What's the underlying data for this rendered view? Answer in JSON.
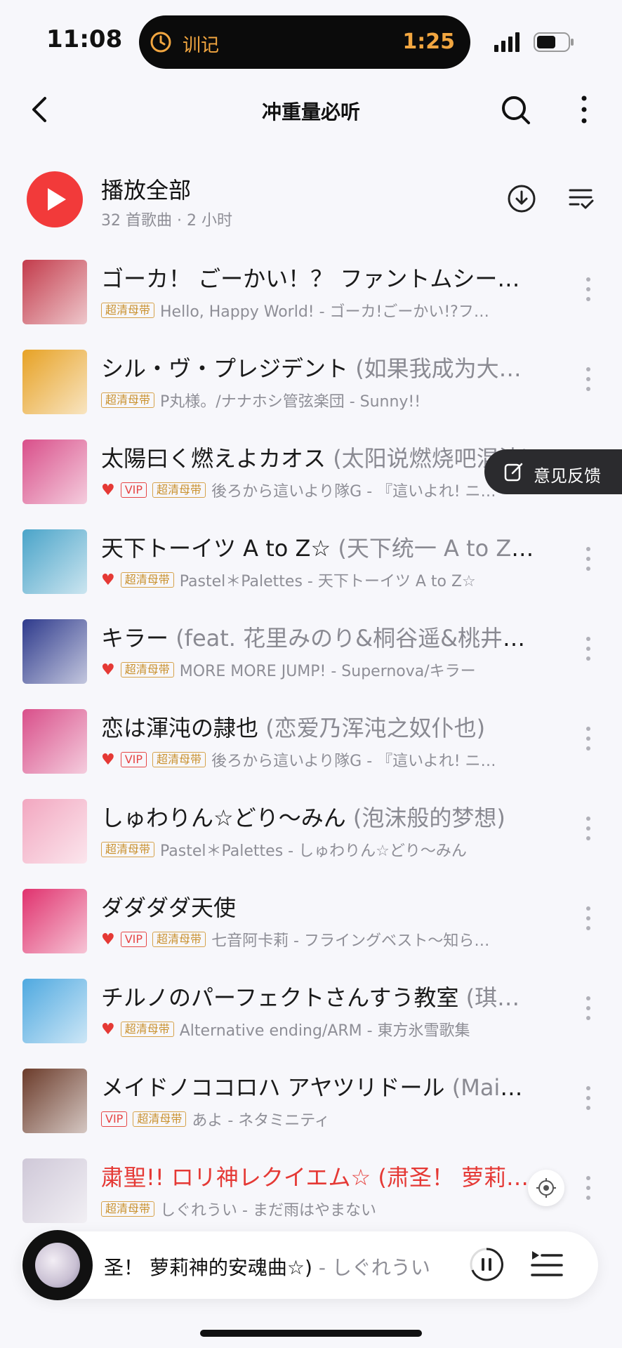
{
  "status_bar": {
    "time": "11:08",
    "island_label": "训记",
    "island_timer": "1:25",
    "island_icon": "timer-icon"
  },
  "header": {
    "title": "冲重量必听",
    "back_icon": "back-chevron-icon",
    "search_icon": "search-icon",
    "more_icon": "more-vertical-icon"
  },
  "play_all": {
    "label": "播放全部",
    "meta": "32 首歌曲 · 2 小时",
    "download_icon": "download-icon",
    "sort_icon": "multi-select-icon"
  },
  "songs": [
    {
      "title": "ゴーカ！ ごーかい！？ ファントムシー…",
      "subtitle": "",
      "heart": false,
      "vip": false,
      "hq": "超清母带",
      "meta": "Hello, Happy World! - ゴーカ!ごーかい!?フ…",
      "cover_color": "#c33b4b"
    },
    {
      "title": "シル・ヴ・プレジデント",
      "subtitle": " (如果我成为大…",
      "heart": false,
      "vip": false,
      "hq": "超清母带",
      "meta": "P丸様。/ナナホシ管弦楽団 - Sunny!!",
      "cover_color": "#e7a225"
    },
    {
      "title": "太陽曰く燃えよカオス",
      "subtitle": " (太阳说燃烧吧混沌)",
      "heart": true,
      "vip": true,
      "hq": "超清母带",
      "meta": "後ろから這いより隊G - 『這いよれ! ニ…",
      "cover_color": "#d94f8a"
    },
    {
      "title": "天下トーイツ A to Z☆",
      "subtitle": " (天下统一 A to Z☆)",
      "heart": true,
      "vip": false,
      "hq": "超清母带",
      "meta": "Pastel＊Palettes - 天下トーイツ A to Z☆",
      "cover_color": "#4aa4c9"
    },
    {
      "title": "キラー",
      "subtitle": " (feat. 花里みのり&桐谷遥&桃井愛…",
      "heart": true,
      "vip": false,
      "hq": "超清母带",
      "meta": "MORE MORE JUMP!   - Supernova/キラー",
      "cover_color": "#2e3a8c"
    },
    {
      "title": "恋は渾沌の隷也",
      "subtitle": " (恋爱乃浑沌之奴仆也)",
      "heart": true,
      "vip": true,
      "hq": "超清母带",
      "meta": "後ろから這いより隊G - 『這いよれ! ニ…",
      "cover_color": "#d94f8a"
    },
    {
      "title": "しゅわりん☆どり～みん",
      "subtitle": " (泡沫般的梦想)",
      "heart": false,
      "vip": false,
      "hq": "超清母带",
      "meta": "Pastel＊Palettes - しゅわりん☆どり～みん",
      "cover_color": "#f2a7c0"
    },
    {
      "title": "ダダダダ天使",
      "subtitle": "",
      "heart": true,
      "vip": true,
      "hq": "超清母带",
      "meta": "七音阿卡莉 - フライングベスト～知ら…",
      "cover_color": "#e0326e"
    },
    {
      "title": "チルノのパーフェクトさんすう教室",
      "subtitle": " (琪…",
      "heart": true,
      "vip": false,
      "hq": "超清母带",
      "meta": "Alternative ending/ARM - 東方氷雪歌集",
      "cover_color": "#4fa9e0"
    },
    {
      "title": "メイドノココロハ アヤツリドール",
      "subtitle": " (Maid…",
      "heart": false,
      "vip": true,
      "hq": "超清母带",
      "meta": "あよ - ネタミニティ",
      "cover_color": "#6b3b2a"
    },
    {
      "title": "粛聖!! ロリ神レクイエム☆",
      "subtitle": " (肃圣！ 萝莉神…",
      "heart": false,
      "vip": false,
      "hq": "超清母带",
      "meta": "しぐれうい - まだ雨はやまない",
      "cover_color": "#cfc8d8",
      "playing": true
    }
  ],
  "labels": {
    "vip": "VIP",
    "heart": "♥"
  },
  "feedback": {
    "label": "意见反馈",
    "icon": "edit-icon"
  },
  "mini_player": {
    "song": "圣！ 萝莉神的安魂曲☆)",
    "artist": " - しぐれうい",
    "pause_icon": "pause-icon",
    "playlist_icon": "playlist-icon"
  }
}
